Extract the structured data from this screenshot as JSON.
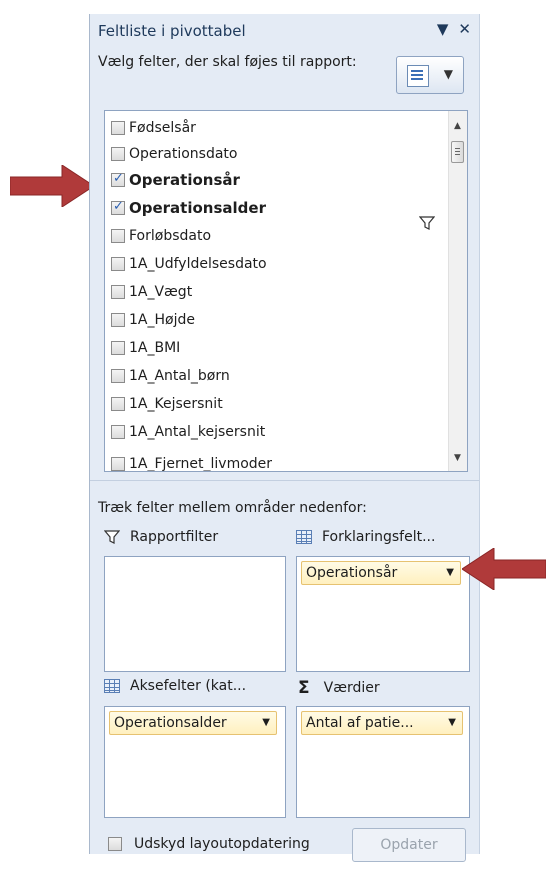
{
  "panel": {
    "title": "Feltliste i pivottabel",
    "dropdown_icon": "▼",
    "close_icon": "✕",
    "choose_text": "Vælg felter, der skal føjes til rapport:",
    "layout_dropdown": "▼"
  },
  "fields": [
    {
      "label": "Fødselsår",
      "checked": false
    },
    {
      "label": "Operationsdato",
      "checked": false
    },
    {
      "label": "Operationsår",
      "checked": true
    },
    {
      "label": "Operationsalder",
      "checked": true
    },
    {
      "label": "Forløbsdato",
      "checked": false
    },
    {
      "label": "1A_Udfyldelsesdato",
      "checked": false
    },
    {
      "label": "1A_Vægt",
      "checked": false
    },
    {
      "label": "1A_Højde",
      "checked": false
    },
    {
      "label": "1A_BMI",
      "checked": false
    },
    {
      "label": "1A_Antal_børn",
      "checked": false
    },
    {
      "label": "1A_Kejsersnit",
      "checked": false
    },
    {
      "label": "1A_Antal_kejsersnit",
      "checked": false
    },
    {
      "label": "1A_Fjernet_livmoder",
      "checked": false
    }
  ],
  "areas": {
    "drag_text": "Træk felter mellem områder nedenfor:",
    "report_filter": "Rapportfilter",
    "legend_fields": "Forklaringsfelt...",
    "axis_fields": "Aksefelter (kat...",
    "values": "Værdier",
    "legend_chip": "Operationsår",
    "axis_chip": "Operationsalder",
    "values_chip": "Antal af patie...",
    "chip_dropdown": "▼"
  },
  "footer": {
    "defer_label": "Udskyd layoutopdatering",
    "update_button": "Opdater"
  },
  "colors": {
    "panel_bg": "#e4ebf5",
    "chip_bg": "#fff0bf",
    "arrow_red": "#b03a3a"
  },
  "icons": [
    "filter-icon",
    "grid-icon",
    "sigma-icon",
    "close-icon",
    "layout-icon"
  ]
}
